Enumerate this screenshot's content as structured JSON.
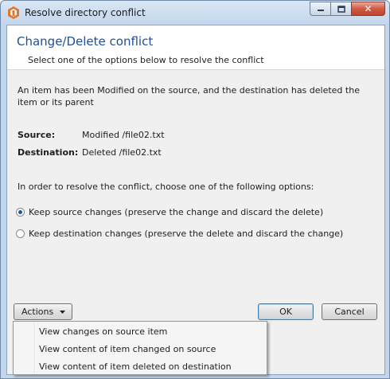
{
  "window": {
    "title": "Resolve directory conflict",
    "close_glyph": "✕"
  },
  "header": {
    "title": "Change/Delete conflict",
    "subtitle": "Select one of the options below to resolve the conflict"
  },
  "body": {
    "description": "An item has been Modified on the source, and the destination has deleted the item or its parent",
    "source_label": "Source:",
    "source_value": "Modified /file02.txt",
    "destination_label": "Destination:",
    "destination_value": "Deleted /file02.txt",
    "instruction": "In order to resolve the conflict, choose one of the following options:",
    "options": [
      {
        "label": "Keep source changes (preserve the change and discard the delete)",
        "selected": true
      },
      {
        "label": "Keep destination changes (preserve the delete and discard the change)",
        "selected": false
      }
    ]
  },
  "footer": {
    "actions_label": "Actions",
    "ok_label": "OK",
    "cancel_label": "Cancel"
  },
  "actions_menu": {
    "items": [
      "View changes on source item",
      "View content of item changed on source",
      "View content of item deleted on destination"
    ]
  },
  "colors": {
    "accent": "#1f4e99",
    "close": "#c0432d"
  },
  "icons": {
    "app": "app-logo-icon",
    "minimize": "minimize-icon",
    "maximize": "maximize-icon",
    "close": "close-icon",
    "dropdown": "chevron-down-icon"
  }
}
